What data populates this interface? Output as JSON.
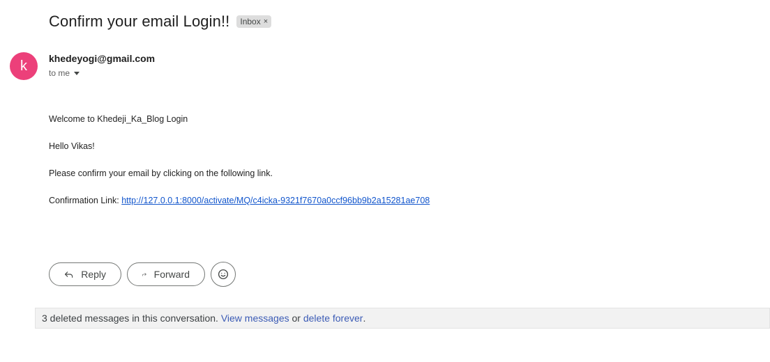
{
  "email": {
    "subject": "Confirm your email Login!!",
    "label_chip": {
      "text": "Inbox",
      "remove": "×"
    },
    "sender": {
      "avatar_letter": "k",
      "address": "khedeyogi@gmail.com",
      "to": "to me"
    },
    "body": {
      "line1": "Welcome to Khedeji_Ka_Blog Login",
      "line2": "Hello Vikas!",
      "line3": "Please confirm your email by clicking on the following link.",
      "link_prefix": "Confirmation Link: ",
      "link_text": "http://127.0.0.1:8000/activate/MQ/c4icka-9321f7670a0ccf96bb9b2a15281ae708"
    }
  },
  "actions": {
    "reply_label": "Reply",
    "forward_label": "Forward"
  },
  "deleted_notice": {
    "text": "3 deleted messages in this conversation. ",
    "view_link": "View messages",
    "or": " or ",
    "delete_link": "delete forever",
    "end": "."
  },
  "colors": {
    "avatar": "#ec407a",
    "link": "#1155cc",
    "chip_bg": "#dddddd"
  },
  "icons": [
    "close-icon",
    "chevron-down-icon",
    "reply-icon",
    "forward-icon",
    "emoji-icon"
  ]
}
